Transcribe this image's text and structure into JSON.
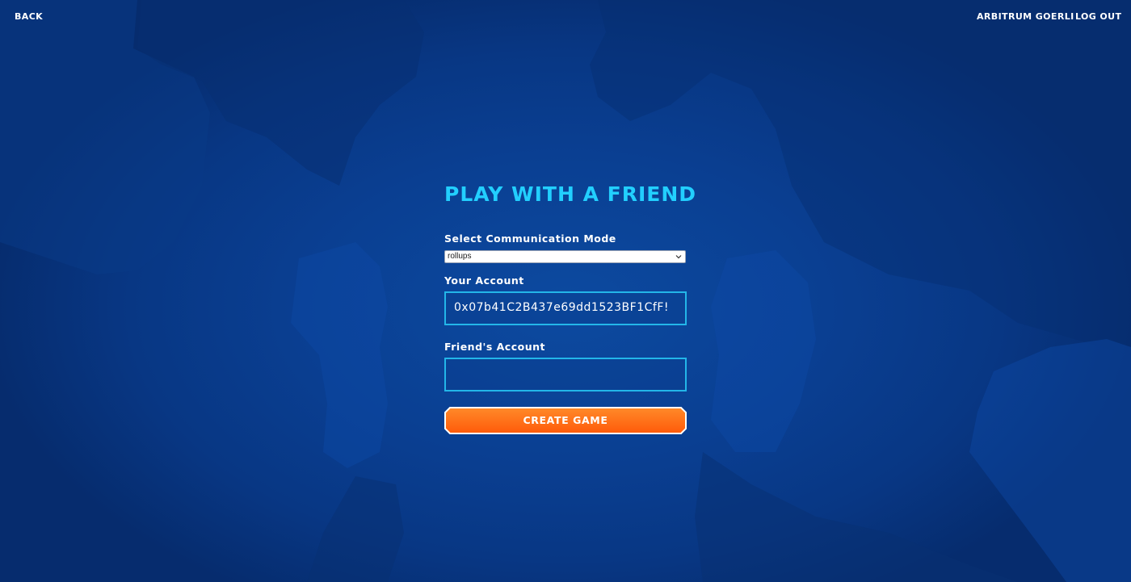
{
  "header": {
    "back_label": "BACK",
    "network_label": "ARBITRUM GOERLI",
    "logout_label": "LOG OUT"
  },
  "panel": {
    "title": "PLAY WITH A FRIEND",
    "mode_label": "Select Communication Mode",
    "mode_selected": "rollups",
    "account_label": "Your Account",
    "account_value": "0x07b41C2B437e69dd1523BF1CfF!",
    "friend_label": "Friend's Account",
    "friend_value": "",
    "create_button_label": "CREATE GAME"
  },
  "theme": {
    "title_color": "#22cfff",
    "field_border_color": "#23b6e9",
    "button_color": "#ff6a13",
    "background_color": "#0a3f92"
  },
  "icons": {
    "select_arrow": "chevron-down-icon"
  }
}
